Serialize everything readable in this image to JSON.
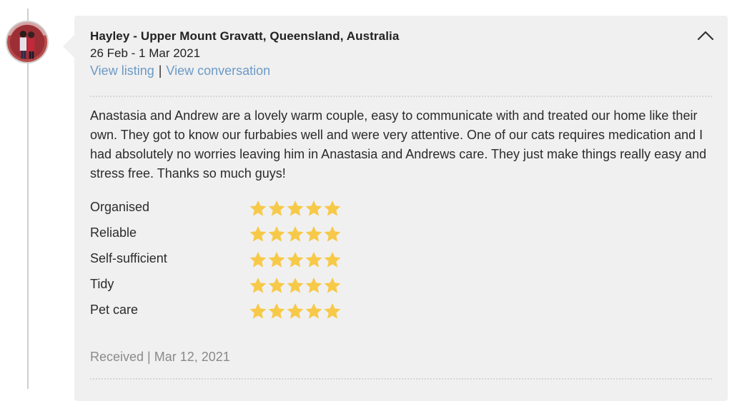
{
  "review": {
    "reviewer": "Hayley - Upper Mount Gravatt, Queensland, Australia",
    "dates": "26 Feb - 1 Mar 2021",
    "links": {
      "view_listing": "View listing",
      "separator": "|",
      "view_conversation": "View conversation"
    },
    "text": "Anastasia and Andrew are a lovely warm couple, easy to communicate with and treated our home like their own. They got to know our furbabies well and were very attentive. One of our cats requires medication and I had absolutely no worries leaving him in Anastasia and Andrews care. They just make things really easy and stress free. Thanks so much guys!",
    "ratings": [
      {
        "label": "Organised",
        "stars": 5
      },
      {
        "label": "Reliable",
        "stars": 5
      },
      {
        "label": "Self-sufficient",
        "stars": 5
      },
      {
        "label": "Tidy",
        "stars": 5
      },
      {
        "label": "Pet care",
        "stars": 5
      }
    ],
    "received": "Received | Mar 12, 2021"
  },
  "icons": {
    "collapse": "chevron-up-icon",
    "star": "star-icon",
    "avatar": "avatar-photo"
  },
  "colors": {
    "star": "#f7c948",
    "link": "#6c9ac6",
    "card_bg": "#f0f0f0",
    "muted_text": "#8a8a8a"
  }
}
